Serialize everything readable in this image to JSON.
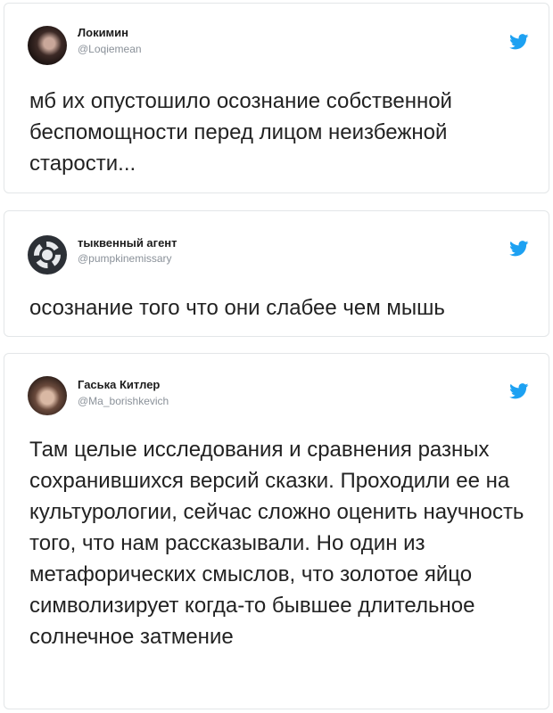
{
  "tweets": [
    {
      "display_name": "Локимин",
      "handle": "@Loqiemean",
      "text": "мб их опустошило осознание собственной беспомощности перед лицом неизбежной старости..."
    },
    {
      "display_name": "тыквенный агент",
      "handle": "@pumpkinemissary",
      "text": "осознание того что они слабее чем мышь"
    },
    {
      "display_name": "Гаська Китлер",
      "handle": "@Ma_borishkevich",
      "text": "Там целые исследования и сравнения разных сохранившихся версий сказки. Проходили ее на культурологии, сейчас сложно оценить научность того, что нам рассказывали. Но один из метафорических смыслов, что золотое яйцо символизирует когда-то бывшее длительное солнечное затмение"
    }
  ],
  "colors": {
    "twitter_blue": "#1da1f2",
    "handle_gray": "#8a9199",
    "border": "#e3e6e8"
  },
  "icons": {
    "brand": "twitter-bird-icon"
  }
}
